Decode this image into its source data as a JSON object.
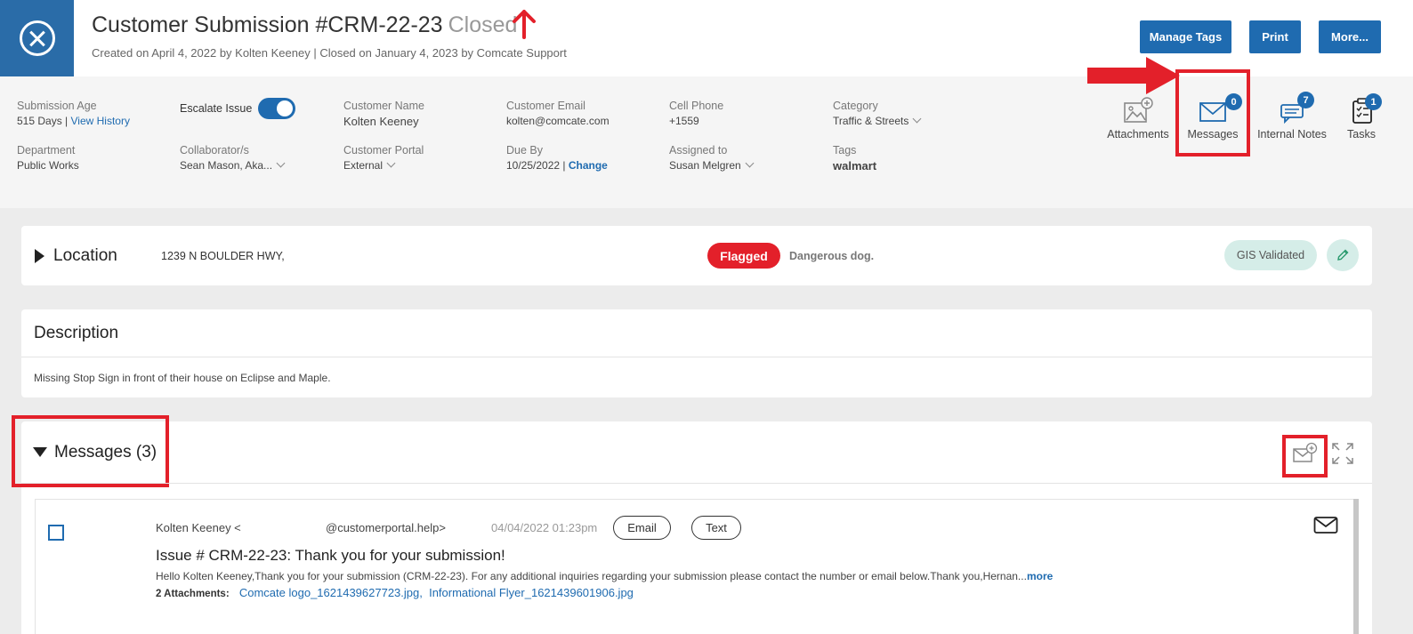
{
  "header": {
    "title": "Customer Submission #CRM-22-23",
    "status": "Closed",
    "subtitle": "Created on April 4, 2022 by Kolten Keeney  | Closed on January 4, 2023 by Comcate Support",
    "buttons": {
      "manage_tags": "Manage Tags",
      "print": "Print",
      "more": "More..."
    }
  },
  "info": {
    "submission_age": {
      "label": "Submission Age",
      "value": "515 Days | ",
      "link": "View History"
    },
    "escalate": {
      "label": "Escalate Issue",
      "enabled": true
    },
    "customer_name": {
      "label": "Customer Name",
      "value": "Kolten Keeney"
    },
    "customer_email": {
      "label": "Customer Email",
      "value": "kolten@comcate.com"
    },
    "cell_phone": {
      "label": "Cell Phone",
      "value": "+1559"
    },
    "category": {
      "label": "Category",
      "value": "Traffic & Streets"
    },
    "department": {
      "label": "Department",
      "value": "Public Works"
    },
    "collaborators": {
      "label": "Collaborator/s",
      "value": "Sean Mason, Aka..."
    },
    "customer_portal": {
      "label": "Customer Portal",
      "value": "External"
    },
    "due_by": {
      "label": "Due By",
      "value": "10/25/2022 | ",
      "link": "Change"
    },
    "assigned_to": {
      "label": "Assigned to",
      "value": "Susan Melgren"
    },
    "tags": {
      "label": "Tags",
      "value": "walmart"
    }
  },
  "quick_actions": [
    {
      "label": "Attachments",
      "icon": "image-add-icon",
      "badge": ""
    },
    {
      "label": "Messages",
      "icon": "envelope-icon",
      "badge": "0"
    },
    {
      "label": "Internal Notes",
      "icon": "chat-note-icon",
      "badge": "7"
    },
    {
      "label": "Tasks",
      "icon": "clipboard-icon",
      "badge": "1"
    }
  ],
  "location": {
    "title": "Location",
    "address": "1239 N BOULDER HWY,",
    "flag_label": "Flagged",
    "flag_note": "Dangerous dog.",
    "gis_label": "GIS Validated"
  },
  "description": {
    "title": "Description",
    "text": "Missing Stop Sign in front of their house on Eclipse and Maple."
  },
  "messages": {
    "title": "Messages (3)",
    "items": [
      {
        "from_name": "Kolten Keeney <",
        "from_domain": "@customerportal.help>",
        "date": "04/04/2022 01:23pm",
        "channels": [
          "Email",
          "Text"
        ],
        "subject": "Issue # CRM-22-23: Thank you for your submission!",
        "body": "Hello Kolten Keeney,Thank you for your submission (CRM-22-23). For any additional inquiries regarding your submission please contact the number or email below.Thank you,Hernan...",
        "more": "more",
        "attachments_label": "2 Attachments:",
        "attachments": [
          "Comcate logo_1621439627723.jpg,",
          "Informational Flyer_1621439601906.jpg"
        ]
      }
    ]
  },
  "colors": {
    "accent": "#1f6bb0",
    "flag": "#e3202a",
    "annotation": "#e3202a",
    "gis_bg": "#d5ede8"
  }
}
